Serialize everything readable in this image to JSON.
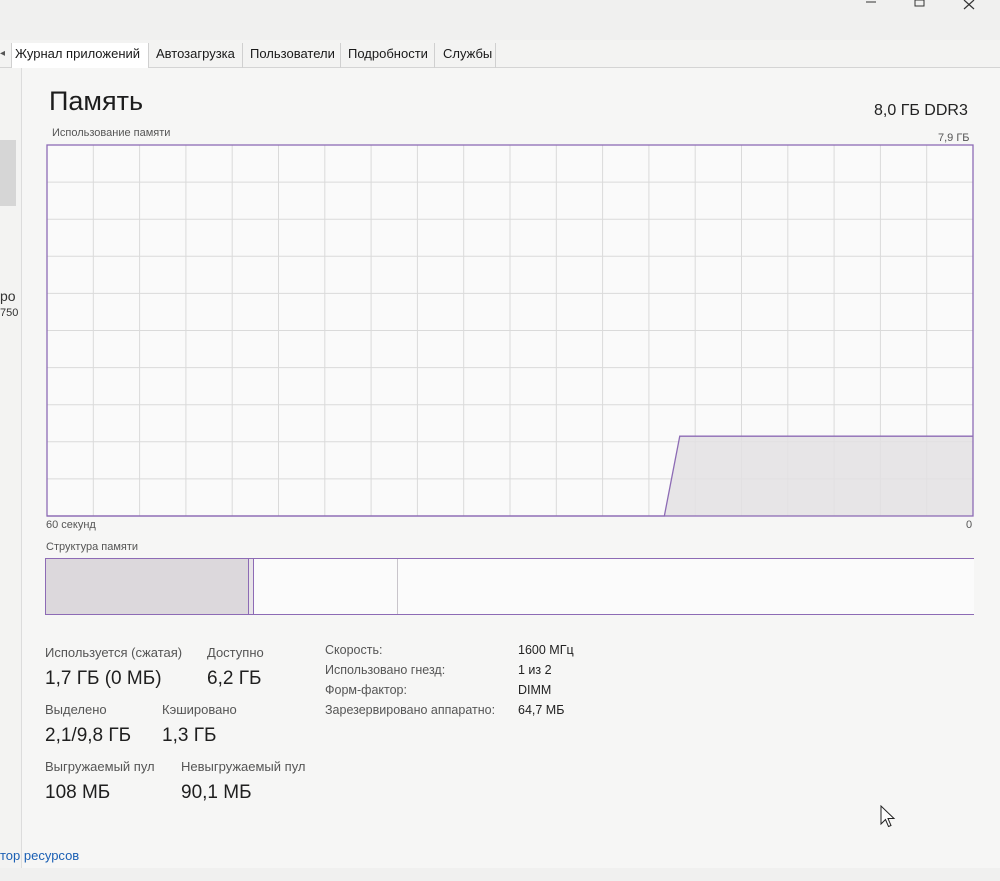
{
  "window": {
    "controls": [
      "minimize-icon",
      "maximize-icon",
      "close-icon"
    ]
  },
  "tabs": [
    {
      "label": "Журнал приложений",
      "active": true
    },
    {
      "label": "Автозагрузка"
    },
    {
      "label": "Пользователи"
    },
    {
      "label": "Подробности"
    },
    {
      "label": "Службы"
    }
  ],
  "sidebar": {
    "clipped_text_1": "ро",
    "clipped_text_2": "750"
  },
  "memory": {
    "title": "Память",
    "type": "8,0 ГБ DDR3",
    "usage_label": "Использование памяти",
    "usage_max": "7,9 ГБ",
    "axis_left": "60 секунд",
    "axis_right": "0",
    "structure_label": "Структура памяти"
  },
  "chart_data": {
    "type": "area",
    "title": "Использование памяти",
    "xlabel": "",
    "ylabel": "",
    "x_tick_labels": [
      "60 секунд",
      "0"
    ],
    "y_max_label": "7,9 ГБ",
    "x": [
      60,
      20,
      19,
      0
    ],
    "values": [
      0,
      0,
      1.7,
      1.7
    ],
    "xlim": [
      60,
      0
    ],
    "ylim": [
      0,
      7.9
    ],
    "grid": true,
    "color": "#8d6bb5"
  },
  "structure": {
    "segments": [
      {
        "name": "in-use",
        "fraction": 0.218
      },
      {
        "name": "modified",
        "fraction": 0.006
      },
      {
        "name": "standby",
        "fraction": 0.155
      },
      {
        "name": "free",
        "fraction": 0.621
      }
    ]
  },
  "stats": {
    "in_use_label": "Используется (сжатая)",
    "in_use_value": "1,7 ГБ (0 МБ)",
    "available_label": "Доступно",
    "available_value": "6,2 ГБ",
    "committed_label": "Выделено",
    "committed_value": "2,1/9,8 ГБ",
    "cached_label": "Кэшировано",
    "cached_value": "1,3 ГБ",
    "paged_label": "Выгружаемый пул",
    "paged_value": "108 МБ",
    "nonpaged_label": "Невыгружаемый пул",
    "nonpaged_value": "90,1 МБ"
  },
  "details": [
    {
      "label": "Скорость:",
      "value": "1600 МГц"
    },
    {
      "label": "Использовано гнезд:",
      "value": "1 из 2"
    },
    {
      "label": "Форм-фактор:",
      "value": "DIMM"
    },
    {
      "label": "Зарезервировано аппаратно:",
      "value": "64,7 МБ"
    }
  ],
  "footer": {
    "link": "тор ресурсов"
  },
  "colors": {
    "accent": "#8d6bb5",
    "fill": "#e3e0e3",
    "grid": "#dadada"
  }
}
